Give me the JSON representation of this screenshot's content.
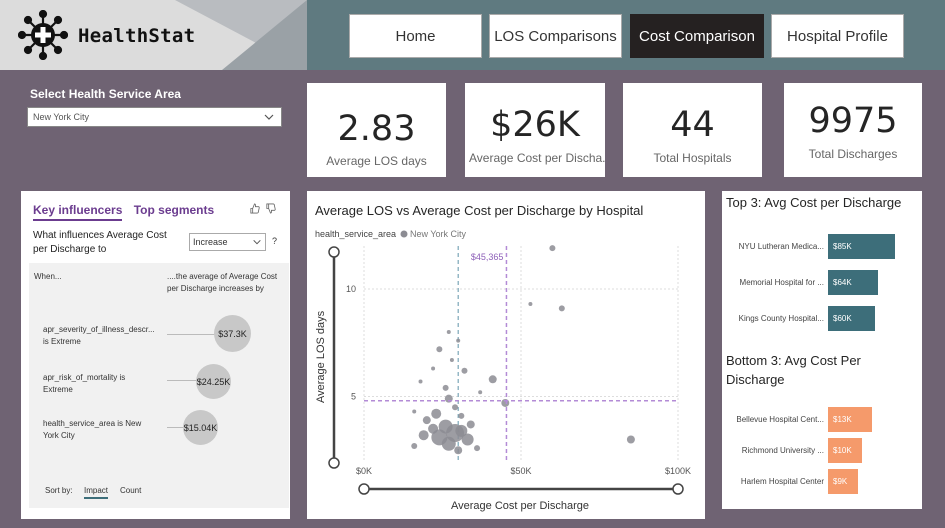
{
  "app": {
    "name": "HealthStat"
  },
  "nav": [
    {
      "label": "Home",
      "active": false
    },
    {
      "label": "LOS Comparisons",
      "active": false
    },
    {
      "label": "Cost Comparison",
      "active": true
    },
    {
      "label": "Hospital Profile",
      "active": false
    }
  ],
  "slicer": {
    "label": "Select Health Service Area",
    "value": "New York City"
  },
  "kpis": [
    {
      "value": "2.83",
      "label": "Average LOS days"
    },
    {
      "value": "$26K",
      "label": "Average Cost per Discha..."
    },
    {
      "value": "44",
      "label": "Total Hospitals"
    },
    {
      "value": "9975",
      "label": "Total Discharges"
    }
  ],
  "key_influencers": {
    "tabs": [
      "Key influencers",
      "Top segments"
    ],
    "question": "What influences Average Cost per Discharge to",
    "direction": "Increase",
    "help": "?",
    "when": "When...",
    "then": "....the average of Average Cost per Discharge increases by",
    "items": [
      {
        "factor": "apr_severity_of_illness_descr... is Extreme",
        "value": "$37.3K",
        "fraction": 1.0
      },
      {
        "factor": "apr_risk_of_mortality is Extreme",
        "value": "$24.25K",
        "fraction": 0.65
      },
      {
        "factor": "health_service_area is New York City",
        "value": "$15.04K",
        "fraction": 0.4
      }
    ],
    "sort_by": "Sort by:",
    "sort_options": [
      "Impact",
      "Count"
    ],
    "sort_active": "Impact"
  },
  "colors": {
    "accent_purple": "#6b3c8f",
    "top_bar": "#3d6e7a",
    "bottom_bar": "#f59a6b",
    "point": "#8c8c93",
    "ref_line": "#b38bd6"
  },
  "chart_data": {
    "type": "scatter",
    "title": "Average LOS vs Average Cost per Discharge by Hospital",
    "legend_title": "health_service_area",
    "legend_items": [
      "New York City"
    ],
    "xlabel": "Average Cost per Discharge",
    "ylabel": "Average LOS days",
    "xlim": [
      0,
      100000
    ],
    "ylim": [
      2,
      12
    ],
    "x_ticks": [
      {
        "value": 0,
        "label": "$0K"
      },
      {
        "value": 50000,
        "label": "$50K"
      },
      {
        "value": 100000,
        "label": "$100K"
      }
    ],
    "y_ticks": [
      {
        "value": 5,
        "label": "5"
      },
      {
        "value": 10,
        "label": "10"
      }
    ],
    "reference_x": {
      "value": 45365,
      "label": "$45,365"
    },
    "reference_y": 4.8,
    "average_x": 30000,
    "points": [
      {
        "x": 60000,
        "y": 11.9,
        "r": 3
      },
      {
        "x": 53000,
        "y": 9.3,
        "r": 2
      },
      {
        "x": 63000,
        "y": 9.1,
        "r": 3
      },
      {
        "x": 27000,
        "y": 8.0,
        "r": 2
      },
      {
        "x": 30000,
        "y": 7.6,
        "r": 2
      },
      {
        "x": 24000,
        "y": 7.2,
        "r": 3
      },
      {
        "x": 22000,
        "y": 6.3,
        "r": 2
      },
      {
        "x": 28000,
        "y": 6.7,
        "r": 2
      },
      {
        "x": 32000,
        "y": 6.2,
        "r": 3
      },
      {
        "x": 41000,
        "y": 5.8,
        "r": 4
      },
      {
        "x": 26000,
        "y": 5.4,
        "r": 3
      },
      {
        "x": 18000,
        "y": 5.7,
        "r": 2
      },
      {
        "x": 37000,
        "y": 5.2,
        "r": 2
      },
      {
        "x": 45000,
        "y": 4.7,
        "r": 4
      },
      {
        "x": 27000,
        "y": 4.9,
        "r": 4
      },
      {
        "x": 29000,
        "y": 4.5,
        "r": 3
      },
      {
        "x": 16000,
        "y": 4.3,
        "r": 2
      },
      {
        "x": 23000,
        "y": 4.2,
        "r": 5
      },
      {
        "x": 31000,
        "y": 4.1,
        "r": 3
      },
      {
        "x": 20000,
        "y": 3.9,
        "r": 4
      },
      {
        "x": 26000,
        "y": 3.6,
        "r": 7
      },
      {
        "x": 29000,
        "y": 3.3,
        "r": 9
      },
      {
        "x": 24000,
        "y": 3.1,
        "r": 8
      },
      {
        "x": 31000,
        "y": 3.4,
        "r": 6
      },
      {
        "x": 22000,
        "y": 3.5,
        "r": 5
      },
      {
        "x": 33000,
        "y": 3.0,
        "r": 6
      },
      {
        "x": 27000,
        "y": 2.8,
        "r": 7
      },
      {
        "x": 19000,
        "y": 3.2,
        "r": 5
      },
      {
        "x": 34000,
        "y": 3.7,
        "r": 4
      },
      {
        "x": 16000,
        "y": 2.7,
        "r": 3
      },
      {
        "x": 36000,
        "y": 2.6,
        "r": 3
      },
      {
        "x": 30000,
        "y": 2.5,
        "r": 4
      },
      {
        "x": 85000,
        "y": 3.0,
        "r": 4
      }
    ]
  },
  "top3": {
    "title": "Top 3: Avg Cost per Discharge",
    "items": [
      {
        "name": "NYU Lutheran Medica...",
        "value": 85,
        "label": "$85K"
      },
      {
        "name": "Memorial Hospital for ...",
        "value": 64,
        "label": "$64K"
      },
      {
        "name": "Kings County Hospital...",
        "value": 60,
        "label": "$60K"
      }
    ]
  },
  "bottom3": {
    "title": "Bottom 3: Avg Cost Per Discharge",
    "items": [
      {
        "name": "Bellevue Hospital Cent...",
        "value": 13,
        "label": "$13K"
      },
      {
        "name": "Richmond University ...",
        "value": 10,
        "label": "$10K"
      },
      {
        "name": "Harlem Hospital Center",
        "value": 9,
        "label": "$9K"
      }
    ]
  }
}
